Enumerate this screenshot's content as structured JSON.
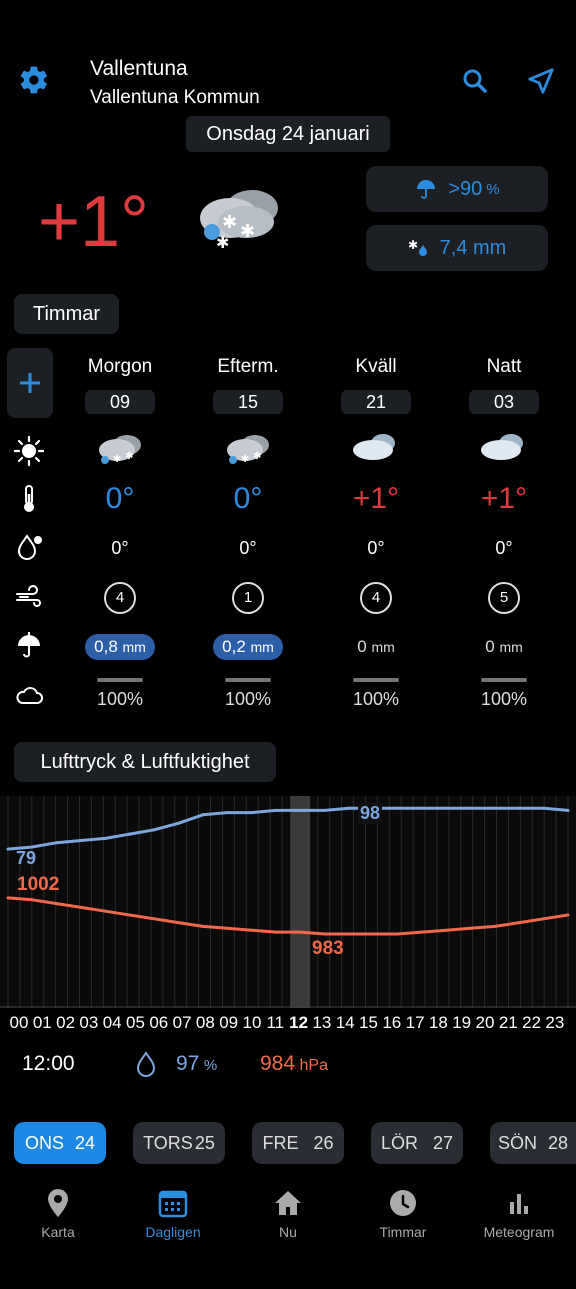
{
  "header": {
    "city": "Vallentuna",
    "municipality": "Vallentuna Kommun",
    "date": "Onsdag 24 januari"
  },
  "current": {
    "temp": "+1°",
    "precip_chance": ">90",
    "precip_chance_unit": "%",
    "precip_amount": "7,4 mm",
    "icon": "snow-cloud-icon"
  },
  "hours_tab": "Timmar",
  "periods": [
    {
      "name": "Morgon",
      "time": "09",
      "temp": "0°",
      "dew": "0°",
      "wind": "4",
      "precip": "0,8",
      "precip_unit": "mm",
      "cloud": "100%"
    },
    {
      "name": "Efterm.",
      "time": "15",
      "temp": "0°",
      "dew": "0°",
      "wind": "1",
      "precip": "0,2",
      "precip_unit": "mm",
      "cloud": "100%"
    },
    {
      "name": "Kväll",
      "time": "21",
      "temp": "+1°",
      "dew": "0°",
      "wind": "4",
      "precip": "0",
      "precip_unit": "mm",
      "cloud": "100%"
    },
    {
      "name": "Natt",
      "time": "03",
      "temp": "+1°",
      "dew": "0°",
      "wind": "5",
      "precip": "0",
      "precip_unit": "mm",
      "cloud": "100%"
    }
  ],
  "pressure_section": {
    "title": "Lufttryck & Luftfuktighet",
    "humidity_start": "79",
    "humidity_peak": "98",
    "pressure_start": "1002",
    "pressure_min": "983",
    "hours": [
      "00",
      "01",
      "02",
      "03",
      "04",
      "05",
      "06",
      "07",
      "08",
      "09",
      "10",
      "11",
      "12",
      "13",
      "14",
      "15",
      "16",
      "17",
      "18",
      "19",
      "20",
      "21",
      "22",
      "23"
    ],
    "selected_time": "12:00",
    "selected_humidity": "97",
    "selected_humidity_unit": "%",
    "selected_pressure": "984",
    "selected_pressure_unit": "hPa"
  },
  "chart_data": {
    "type": "line",
    "x": [
      "00",
      "01",
      "02",
      "03",
      "04",
      "05",
      "06",
      "07",
      "08",
      "09",
      "10",
      "11",
      "12",
      "13",
      "14",
      "15",
      "16",
      "17",
      "18",
      "19",
      "20",
      "21",
      "22",
      "23"
    ],
    "series": [
      {
        "values": [
          79,
          80,
          82,
          83,
          84,
          86,
          88,
          91,
          95,
          96,
          96,
          97,
          97,
          97,
          98,
          98,
          98,
          98,
          98,
          98,
          98,
          98,
          98,
          97
        ]
      },
      {
        "values": [
          1002,
          1001,
          999,
          997,
          995,
          993,
          991,
          989,
          987,
          986,
          985,
          984,
          984,
          983,
          983,
          983,
          983,
          984,
          985,
          986,
          987,
          989,
          991,
          993
        ]
      }
    ],
    "colors": [
      "#7ea6de",
      "#f06a4a"
    ],
    "selected_x": "12"
  },
  "days": [
    {
      "label": "ONS",
      "num": "24",
      "active": true
    },
    {
      "label": "TORS",
      "num": "25"
    },
    {
      "label": "FRE",
      "num": "26"
    },
    {
      "label": "LÖR",
      "num": "27"
    },
    {
      "label": "SÖN",
      "num": "28"
    }
  ],
  "nav": [
    {
      "label": "Karta",
      "icon": "map-pin-icon"
    },
    {
      "label": "Dagligen",
      "icon": "calendar-icon",
      "active": true
    },
    {
      "label": "Nu",
      "icon": "home-icon"
    },
    {
      "label": "Timmar",
      "icon": "clock-icon"
    },
    {
      "label": "Meteogram",
      "icon": "bar-chart-icon"
    }
  ],
  "colors": {
    "accent": "#2b8de0",
    "warm": "#e0393e",
    "humidity_line": "#7ea6de",
    "pressure_line": "#f06a4a"
  }
}
